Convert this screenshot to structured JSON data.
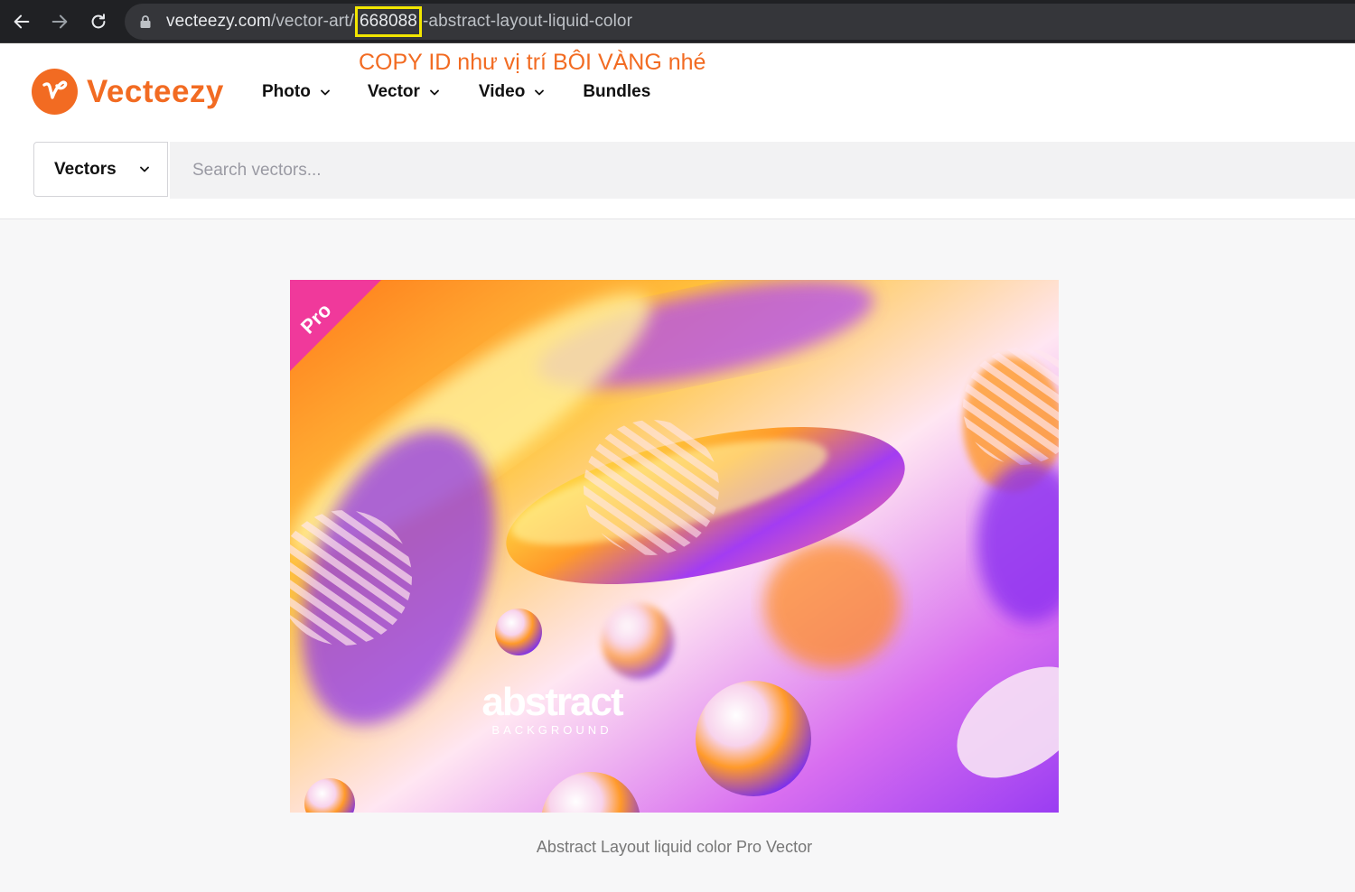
{
  "browser": {
    "url_domain": "vecteezy.com",
    "url_path_before": "/vector-art/",
    "url_id": "668088",
    "url_path_after": "-abstract-layout-liquid-color"
  },
  "annotation": "COPY ID như vị trí BÔI VÀNG nhé",
  "header": {
    "logo_text": "Vecteezy",
    "nav": [
      {
        "label": "Photo",
        "has_dropdown": true
      },
      {
        "label": "Vector",
        "has_dropdown": true
      },
      {
        "label": "Video",
        "has_dropdown": true
      },
      {
        "label": "Bundles",
        "has_dropdown": false
      }
    ]
  },
  "search": {
    "type_label": "Vectors",
    "placeholder": "Search vectors..."
  },
  "preview": {
    "badge": "Pro",
    "title_word": "abstract",
    "subtitle_word": "BACKGROUND"
  },
  "caption": "Abstract Layout liquid color Pro Vector",
  "colors": {
    "brand_orange": "#f26b22",
    "highlight_yellow": "#f2e600",
    "badge_pink": "#f0399b"
  }
}
